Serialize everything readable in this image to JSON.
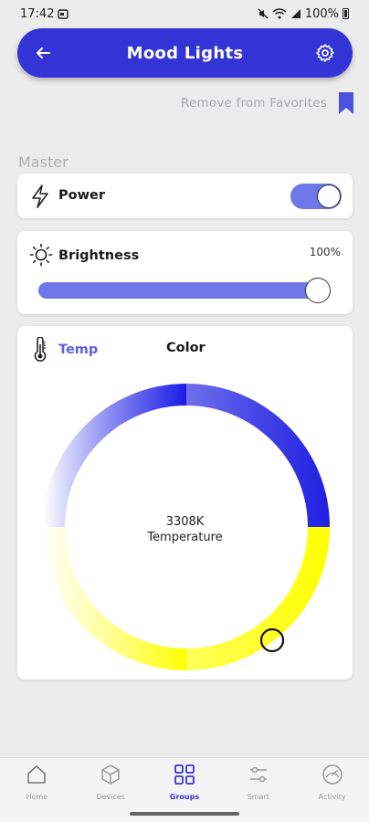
{
  "status_bar": {
    "time": "17:42",
    "battery": "100%"
  },
  "header": {
    "title": "Mood Lights"
  },
  "favorites": {
    "label": "Remove from Favorites"
  },
  "section": {
    "label": "Master"
  },
  "power": {
    "label": "Power",
    "enabled": true
  },
  "brightness": {
    "label": "Brightness",
    "value_text": "100%",
    "level": 1.0
  },
  "color_card": {
    "tab_temp": "Temp",
    "tab_color": "Color",
    "temperature_value": "3308K",
    "temperature_label": "Temperature"
  },
  "colors": {
    "accent": "#3434d6",
    "toggle": "#6f76e8",
    "cool": "#2020e0",
    "warm": "#ffff00"
  },
  "nav": [
    {
      "label": "Home",
      "icon": "home-icon",
      "active": false
    },
    {
      "label": "Devices",
      "icon": "cube-icon",
      "active": false
    },
    {
      "label": "Groups",
      "icon": "grid-icon",
      "active": true
    },
    {
      "label": "Smart",
      "icon": "sliders-icon",
      "active": false
    },
    {
      "label": "Activity",
      "icon": "gauge-icon",
      "active": false
    }
  ]
}
